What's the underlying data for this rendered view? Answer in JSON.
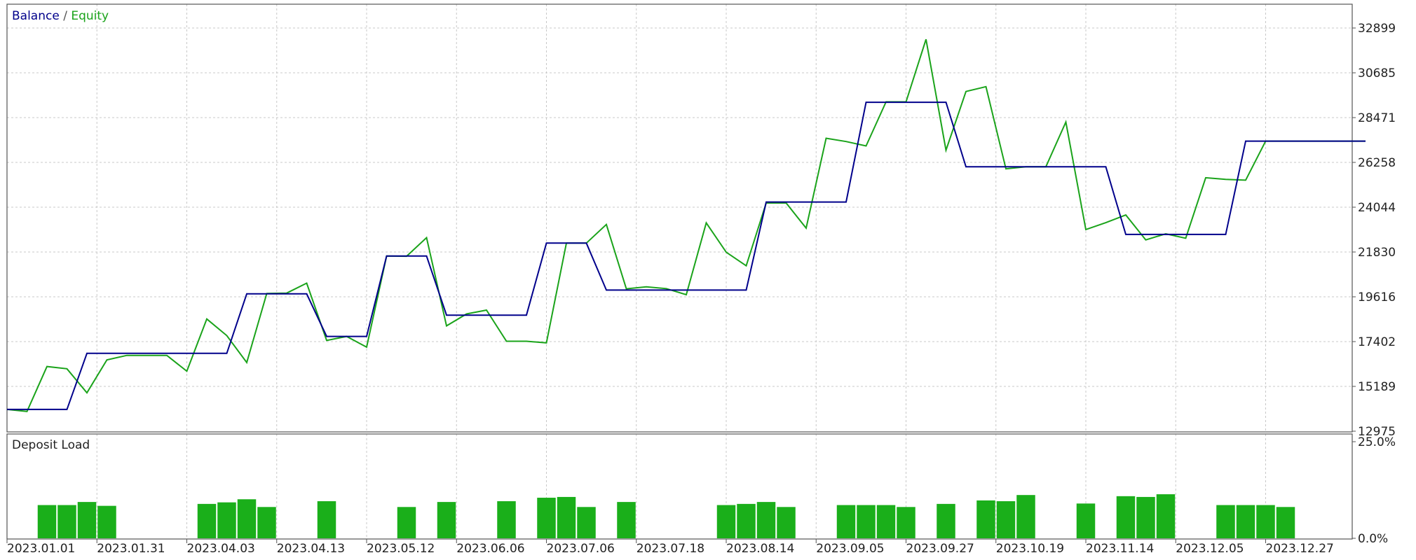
{
  "chart_data": {
    "type": "line",
    "top_panel": {
      "legend": {
        "balance_label": "Balance",
        "separator": " / ",
        "equity_label": "Equity"
      },
      "y_ticks": [
        "32899",
        "30685",
        "28471",
        "26258",
        "24044",
        "21830",
        "19616",
        "17402",
        "15189",
        "12975"
      ],
      "ylim": [
        12975,
        32899
      ],
      "series": [
        {
          "name": "Balance",
          "color": "#00008b",
          "x": [
            0,
            3,
            4,
            11,
            12,
            15,
            16,
            18,
            19,
            21,
            22,
            26,
            27,
            29,
            30,
            37,
            38,
            39,
            40,
            42,
            43,
            45,
            46,
            47,
            48,
            50,
            51,
            55,
            56,
            58,
            59,
            61,
            62,
            64,
            65,
            68
          ],
          "values": [
            14050,
            14050,
            16820,
            16820,
            19760,
            19760,
            17660,
            17660,
            21630,
            21630,
            18710,
            18710,
            22270,
            22270,
            19950,
            19950,
            24300,
            24300,
            24300,
            24300,
            29230,
            29230,
            29230,
            29230,
            26040,
            26040,
            26040,
            26040,
            22700,
            22700,
            22700,
            22700,
            27310,
            27310,
            27310,
            27310
          ]
        },
        {
          "name": "Equity",
          "color": "#1aa31a",
          "x": [
            0,
            1,
            2,
            3,
            4,
            5,
            6,
            7,
            8,
            9,
            10,
            11,
            12,
            13,
            14,
            15,
            16,
            17,
            18,
            19,
            20,
            21,
            22,
            23,
            24,
            25,
            26,
            27,
            28,
            29,
            30,
            31,
            32,
            33,
            34,
            35,
            36,
            37,
            38,
            39,
            40,
            41,
            42,
            43,
            44,
            45,
            46,
            47,
            48,
            49,
            50,
            51,
            52,
            53,
            54,
            55,
            56,
            57,
            58,
            59,
            60,
            61,
            62,
            63,
            64,
            65,
            66,
            67,
            68
          ],
          "values": [
            14050,
            13950,
            16170,
            16060,
            14870,
            16500,
            16720,
            16720,
            16720,
            15940,
            18520,
            17700,
            16370,
            19780,
            19800,
            20290,
            17460,
            17660,
            17130,
            21630,
            21620,
            22540,
            18180,
            18770,
            18960,
            17420,
            17420,
            17340,
            22270,
            22270,
            23190,
            20010,
            20110,
            20020,
            19720,
            23270,
            21820,
            21150,
            24250,
            24250,
            23010,
            27450,
            27290,
            27070,
            29250,
            29250,
            32340,
            26860,
            29760,
            30000,
            25940,
            26040,
            26040,
            28250,
            22940,
            23280,
            23660,
            22430,
            22730,
            22510,
            25500,
            25420,
            25380,
            27310,
            27310,
            27310,
            27310,
            27310,
            27310
          ]
        }
      ]
    },
    "bottom_panel": {
      "title": "Deposit Load",
      "y_ticks": [
        "25.0%",
        "0.0%"
      ],
      "ylim": [
        0,
        25
      ],
      "bars": [
        {
          "x": 2,
          "value": 8.6
        },
        {
          "x": 3,
          "value": 8.6
        },
        {
          "x": 4,
          "value": 9.4
        },
        {
          "x": 5,
          "value": 8.4
        },
        {
          "x": 10,
          "value": 8.9
        },
        {
          "x": 11,
          "value": 9.3
        },
        {
          "x": 12,
          "value": 10.1
        },
        {
          "x": 13,
          "value": 8.1
        },
        {
          "x": 16,
          "value": 9.6
        },
        {
          "x": 20,
          "value": 8.1
        },
        {
          "x": 22,
          "value": 9.4
        },
        {
          "x": 25,
          "value": 9.6
        },
        {
          "x": 27,
          "value": 10.5
        },
        {
          "x": 28,
          "value": 10.7
        },
        {
          "x": 29,
          "value": 8.1
        },
        {
          "x": 31,
          "value": 9.4
        },
        {
          "x": 36,
          "value": 8.6
        },
        {
          "x": 37,
          "value": 8.9
        },
        {
          "x": 38,
          "value": 9.4
        },
        {
          "x": 39,
          "value": 8.1
        },
        {
          "x": 42,
          "value": 8.6
        },
        {
          "x": 43,
          "value": 8.6
        },
        {
          "x": 44,
          "value": 8.6
        },
        {
          "x": 45,
          "value": 8.1
        },
        {
          "x": 47,
          "value": 8.9
        },
        {
          "x": 49,
          "value": 9.8
        },
        {
          "x": 50,
          "value": 9.6
        },
        {
          "x": 51,
          "value": 11.2
        },
        {
          "x": 54,
          "value": 9.0
        },
        {
          "x": 56,
          "value": 10.9
        },
        {
          "x": 57,
          "value": 10.7
        },
        {
          "x": 58,
          "value": 11.4
        },
        {
          "x": 61,
          "value": 8.6
        },
        {
          "x": 62,
          "value": 8.6
        },
        {
          "x": 63,
          "value": 8.6
        },
        {
          "x": 64,
          "value": 8.1
        }
      ],
      "bar_color": "#1aaf1a"
    },
    "x_tick_labels": [
      "2023.01.01",
      "2023.01.31",
      "2023.04.03",
      "2023.04.13",
      "2023.05.12",
      "2023.06.06",
      "2023.07.06",
      "2023.07.18",
      "2023.08.14",
      "2023.09.05",
      "2023.09.27",
      "2023.10.19",
      "2023.11.14",
      "2023.12.05",
      "2023.12.27"
    ],
    "x_tick_positions": [
      0,
      4.5,
      9,
      13.5,
      18,
      22.5,
      27,
      31.5,
      36,
      40.5,
      45,
      49.5,
      54,
      58.5,
      63
    ],
    "grid": true,
    "grid_color": "#c8c8c8"
  }
}
